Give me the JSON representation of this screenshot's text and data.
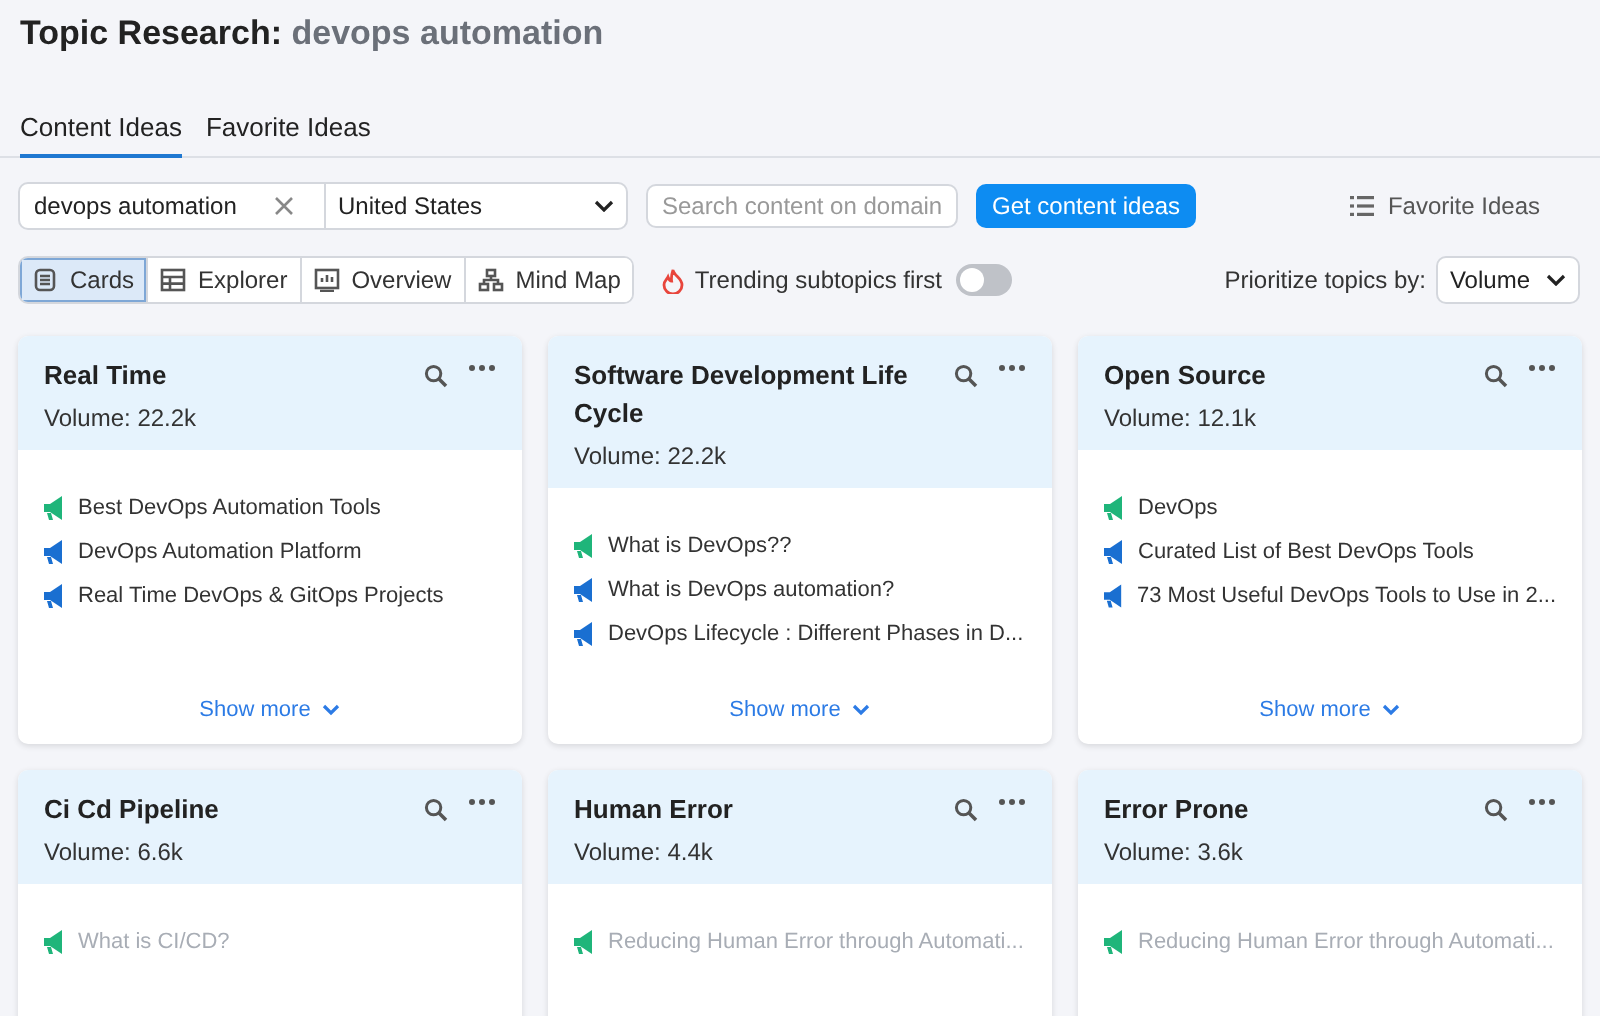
{
  "page_title": {
    "label": "Topic Research:",
    "query": "devops automation"
  },
  "tabs": [
    {
      "label": "Content Ideas",
      "selected": true
    },
    {
      "label": "Favorite Ideas",
      "selected": false
    }
  ],
  "search": {
    "value": "devops automation",
    "country": "United States",
    "domain_placeholder": "Search content on domain",
    "submit": "Get content ideas",
    "favorites_link": "Favorite Ideas"
  },
  "views": [
    {
      "label": "Cards",
      "kind": "cards",
      "selected": true
    },
    {
      "label": "Explorer",
      "kind": "explorer",
      "selected": false
    },
    {
      "label": "Overview",
      "kind": "overview",
      "selected": false
    },
    {
      "label": "Mind Map",
      "kind": "mindmap",
      "selected": false
    }
  ],
  "trending": {
    "label": "Trending subtopics first",
    "on": false
  },
  "prioritize": {
    "label": "Prioritize topics by:",
    "value": "Volume"
  },
  "cards": [
    {
      "title": "Real Time",
      "volume": "Volume: 22.2k",
      "ideas": [
        {
          "text": "Best DevOps Automation Tools",
          "color": "#1fb57a"
        },
        {
          "text": "DevOps Automation Platform",
          "color": "#1a6fd1"
        },
        {
          "text": "Real Time DevOps & GitOps Projects",
          "color": "#1a6fd1"
        }
      ],
      "more": "Show more"
    },
    {
      "title": "Software Development Life Cycle",
      "volume": "Volume: 22.2k",
      "ideas": [
        {
          "text": "What is DevOps??",
          "color": "#1fb57a"
        },
        {
          "text": "What is DevOps automation?",
          "color": "#1a6fd1"
        },
        {
          "text": "DevOps Lifecycle : Different Phases in D...",
          "color": "#1a6fd1"
        }
      ],
      "more": "Show more"
    },
    {
      "title": "Open Source",
      "volume": "Volume: 12.1k",
      "ideas": [
        {
          "text": "DevOps",
          "color": "#1fb57a"
        },
        {
          "text": "Curated List of Best DevOps Tools",
          "color": "#1a6fd1"
        },
        {
          "text": "73 Most Useful DevOps Tools to Use in 2...",
          "color": "#1a6fd1"
        }
      ],
      "more": "Show more"
    },
    {
      "title": "Ci Cd Pipeline",
      "volume": "Volume: 6.6k",
      "ideas": [
        {
          "text": "What is CI/CD?",
          "color": "#1fb57a"
        }
      ]
    },
    {
      "title": "Human Error",
      "volume": "Volume: 4.4k",
      "ideas": [
        {
          "text": "Reducing Human Error through Automati...",
          "color": "#1fb57a"
        }
      ]
    },
    {
      "title": "Error Prone",
      "volume": "Volume: 3.6k",
      "ideas": [
        {
          "text": "Reducing Human Error through Automati...",
          "color": "#1fb57a"
        }
      ]
    }
  ]
}
